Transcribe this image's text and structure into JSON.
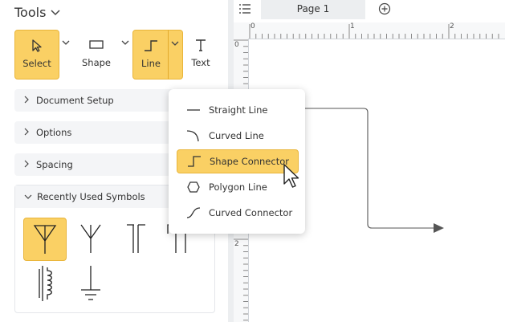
{
  "tools_panel": {
    "title": "Tools",
    "tools": [
      {
        "label": "Select",
        "icon": "cursor-icon",
        "selected": true
      },
      {
        "label": "Shape",
        "icon": "rectangle-icon",
        "selected": false
      },
      {
        "label": "Line",
        "icon": "connector-line-icon",
        "selected": true
      },
      {
        "label": "Text",
        "icon": "text-icon",
        "selected": false
      }
    ],
    "sections": [
      {
        "label": "Document Setup",
        "expanded": false
      },
      {
        "label": "Options",
        "expanded": false
      },
      {
        "label": "Spacing",
        "expanded": false
      },
      {
        "label": "Recently Used Symbols",
        "expanded": true
      }
    ],
    "symbols": [
      "antenna-symbol-icon",
      "antenna-y-symbol-icon",
      "double-post-symbol-icon",
      "t-post-symbol-icon",
      "inductor-core-symbol-icon",
      "ground-symbol-icon"
    ]
  },
  "line_menu": {
    "options": [
      {
        "label": "Straight Line",
        "icon": "straight-line-icon"
      },
      {
        "label": "Curved Line",
        "icon": "curved-line-icon"
      },
      {
        "label": "Shape Connector",
        "icon": "shape-connector-icon",
        "highlighted": true
      },
      {
        "label": "Polygon Line",
        "icon": "polygon-line-icon"
      },
      {
        "label": "Curved Connector",
        "icon": "curved-connector-icon"
      }
    ]
  },
  "canvas": {
    "page_tab": "Page 1",
    "ruler_h_labels": [
      "0",
      "1",
      "2"
    ],
    "ruler_v_labels": [
      "0",
      "1",
      "2"
    ]
  },
  "colors": {
    "accent": "#fad064",
    "accent_border": "#e9b53a",
    "panel_bg": "#f4f5f7"
  }
}
